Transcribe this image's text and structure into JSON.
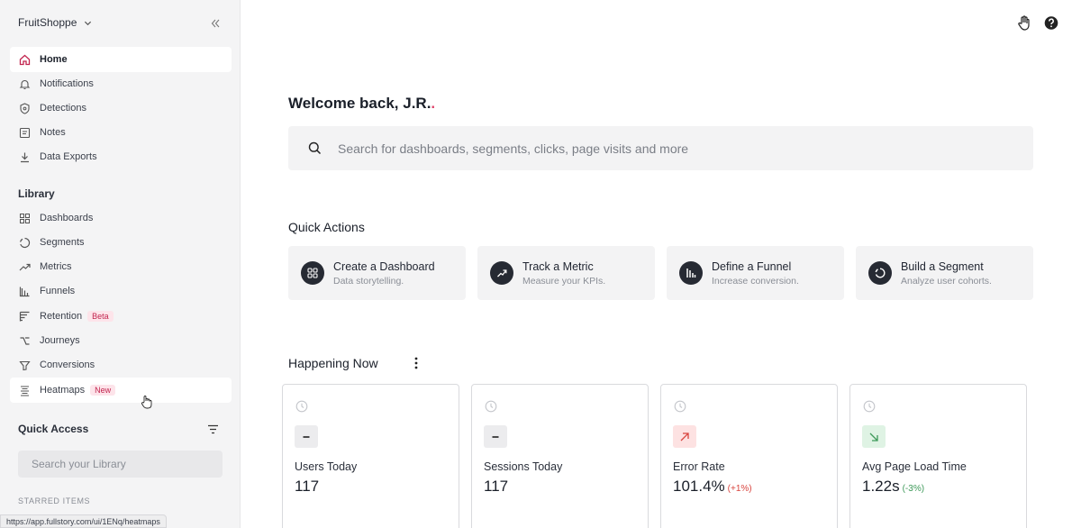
{
  "sidebar": {
    "org_name": "FruitShoppe",
    "nav": [
      {
        "label": "Home",
        "icon": "home-icon"
      },
      {
        "label": "Notifications",
        "icon": "bell-icon"
      },
      {
        "label": "Detections",
        "icon": "shield-icon"
      },
      {
        "label": "Notes",
        "icon": "notes-icon"
      },
      {
        "label": "Data Exports",
        "icon": "download-icon"
      }
    ],
    "library_title": "Library",
    "library": [
      {
        "label": "Dashboards",
        "icon": "grid-icon"
      },
      {
        "label": "Segments",
        "icon": "segment-icon"
      },
      {
        "label": "Metrics",
        "icon": "trend-icon"
      },
      {
        "label": "Funnels",
        "icon": "funnel-icon"
      },
      {
        "label": "Retention",
        "icon": "retention-icon",
        "badge": "Beta"
      },
      {
        "label": "Journeys",
        "icon": "journey-icon"
      },
      {
        "label": "Conversions",
        "icon": "conversion-icon"
      },
      {
        "label": "Heatmaps",
        "icon": "heatmap-icon",
        "badge": "New"
      }
    ],
    "quick_access_title": "Quick Access",
    "library_search_placeholder": "Search your Library",
    "starred_title": "STARRED ITEMS",
    "status_url": "https://app.fullstory.com/ui/1ENq/heatmaps"
  },
  "main": {
    "welcome_prefix": "Welcome back, J.R.",
    "welcome_dot": ".",
    "search_placeholder": "Search for dashboards, segments, clicks, page visits and more",
    "quick_actions_title": "Quick Actions",
    "quick_actions": [
      {
        "title": "Create a Dashboard",
        "subtitle": "Data storytelling.",
        "icon": "dashboard-icon"
      },
      {
        "title": "Track a Metric",
        "subtitle": "Measure your KPIs.",
        "icon": "trend-up-icon"
      },
      {
        "title": "Define a Funnel",
        "subtitle": "Increase conversion.",
        "icon": "funnel-bars-icon"
      },
      {
        "title": "Build a Segment",
        "subtitle": "Analyze user cohorts.",
        "icon": "segment-ring-icon"
      }
    ],
    "happening_now_title": "Happening Now",
    "metrics": [
      {
        "label": "Users Today",
        "value": "117",
        "delta": "",
        "trend": "flat"
      },
      {
        "label": "Sessions Today",
        "value": "117",
        "delta": "",
        "trend": "flat"
      },
      {
        "label": "Error Rate",
        "value": "101.4%",
        "delta": "(+1%)",
        "trend": "up"
      },
      {
        "label": "Avg Page Load Time",
        "value": "1.22s",
        "delta": "(-3%)",
        "trend": "down"
      }
    ]
  },
  "colors": {
    "accent_pink": "#c2254f",
    "welcome_dot": "#e0466c",
    "trend_up_bg": "#fde2e2",
    "trend_up_fg": "#d9453f",
    "trend_down_bg": "#dff3e4",
    "trend_down_fg": "#3f9a5a",
    "flat_bg": "#ececee"
  }
}
